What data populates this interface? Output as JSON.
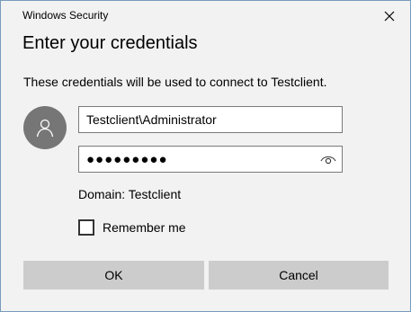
{
  "window": {
    "title": "Windows Security",
    "close_icon": "close-icon"
  },
  "heading": "Enter your credentials",
  "description": "These credentials will be used to connect to Testclient.",
  "avatar": {
    "icon": "user-icon",
    "color": "#767676"
  },
  "username": {
    "value": "Testclient\\Administrator"
  },
  "password": {
    "masked_value": "●●●●●●●●●",
    "reveal_icon": "eye-icon"
  },
  "domain_text": "Domain: Testclient",
  "remember": {
    "label": "Remember me",
    "checked": false
  },
  "buttons": {
    "ok_label": "OK",
    "cancel_label": "Cancel"
  },
  "colors": {
    "dialog_bg": "#f2f2f2",
    "button_bg": "#cccccc",
    "border": "#7a9bbd"
  }
}
